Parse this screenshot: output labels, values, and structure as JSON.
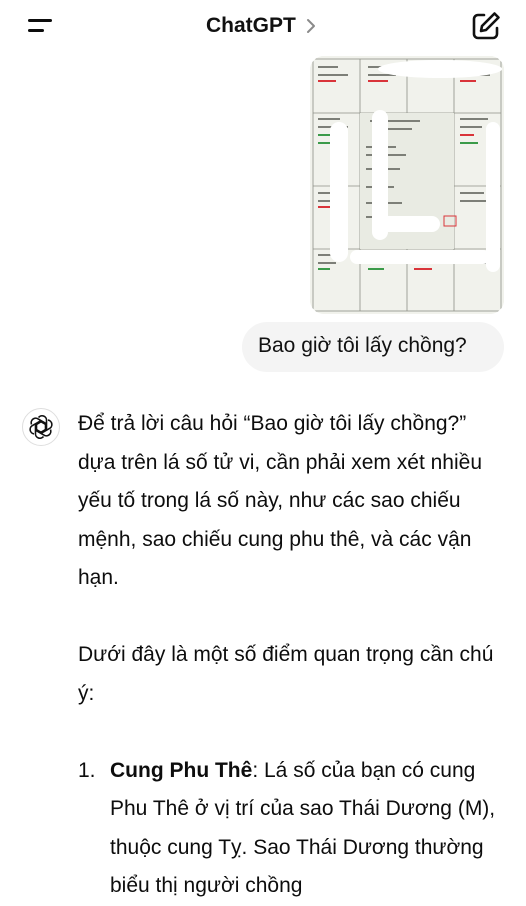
{
  "header": {
    "title": "ChatGPT",
    "menu_icon": "hamburger-icon",
    "title_icon": "chevron-right-icon",
    "new_chat_icon": "compose-icon"
  },
  "conversation": {
    "user_message": "Bao giờ tôi lấy chồng?",
    "assistant_icon": "openai-logo-icon",
    "answer_para1": "Để trả lời câu hỏi “Bao giờ tôi lấy chồng?” dựa trên lá số tử vi, cần phải xem xét nhiều yếu tố trong lá số này, như các sao chiếu mệnh, sao chiếu cung phu thê, và các vận hạn.",
    "answer_para2": "Dưới đây là một số điểm quan trọng cần chú ý:",
    "list_item1_number": "1.",
    "list_item1_title": "Cung Phu Thê",
    "list_item1_text": ": Lá số của bạn có cung Phu Thê ở vị trí của sao Thái Dương (M), thuộc cung Tỵ. Sao Thái Dương thường biểu thị người chồng"
  },
  "colors": {
    "text": "#0d0d0d",
    "bubble": "#f4f4f4",
    "accent_red": "#d9343a",
    "accent_green": "#3b9b4a"
  }
}
